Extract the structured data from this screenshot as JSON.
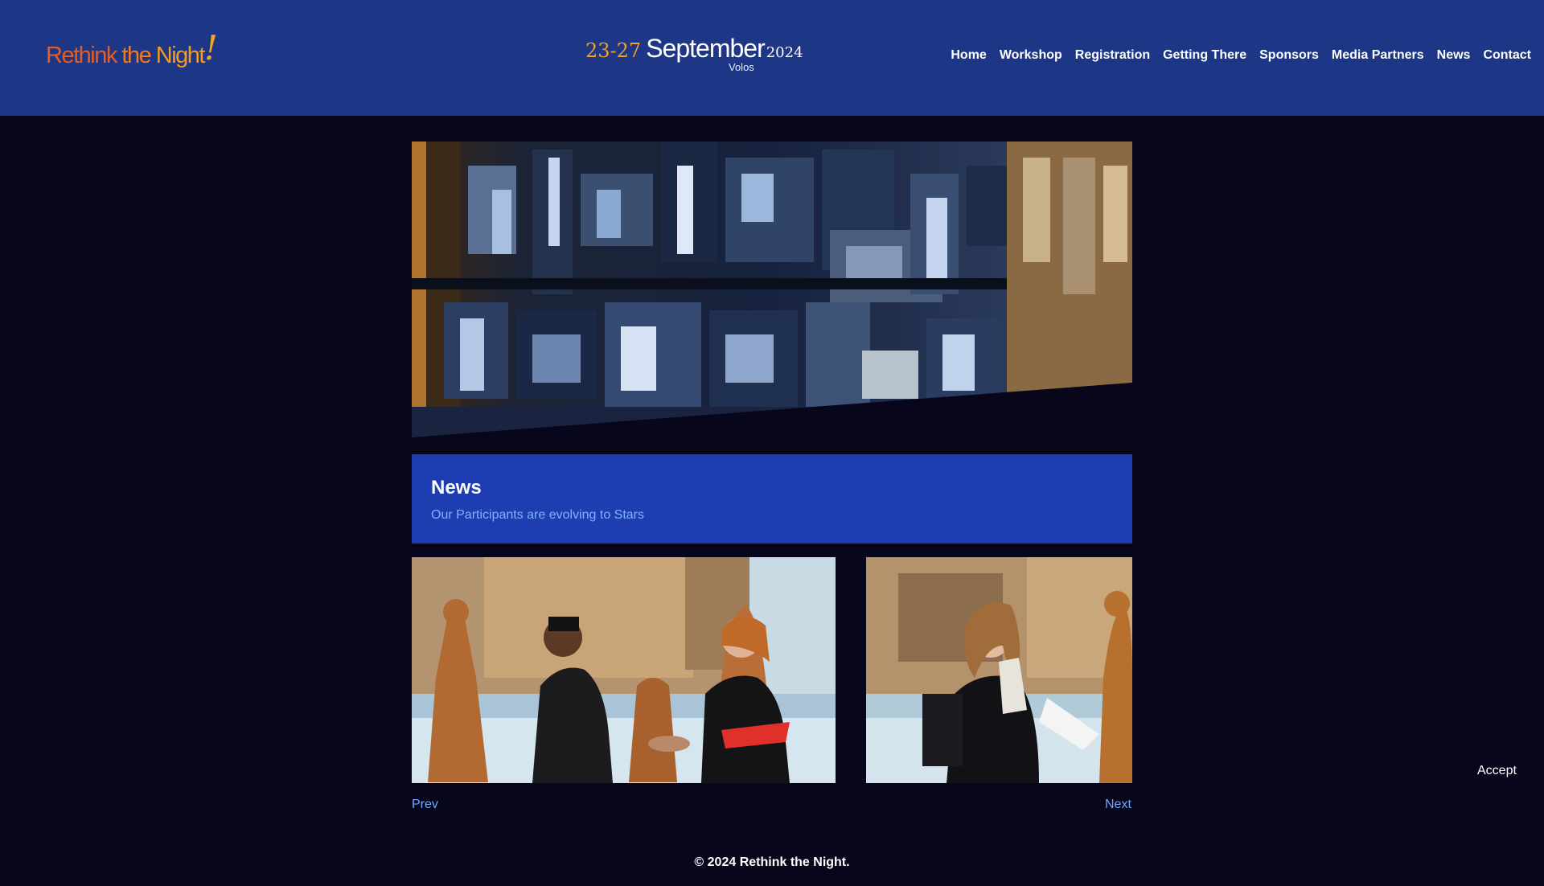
{
  "header": {
    "logo": {
      "part1": "Rethink",
      "part2": " the",
      "part3": " Night",
      "mark": "!"
    },
    "dates": {
      "range": "23-27",
      "month": "September",
      "year": "2024",
      "city": "Volos"
    },
    "nav": [
      "Home",
      "Workshop",
      "Registration",
      "Getting There",
      "Sponsors",
      "Media Partners",
      "News",
      "Contact"
    ]
  },
  "news": {
    "title": "News",
    "subtitle": "Our Participants are evolving to Stars"
  },
  "pager": {
    "prev": "Prev",
    "next": "Next"
  },
  "cookie": {
    "accept": "Accept"
  },
  "footer": {
    "copyright": "© 2024 Rethink the Night."
  },
  "colors": {
    "header_bg": "#1d3686",
    "page_bg": "#07061b",
    "news_bg": "#1e3db0",
    "link": "#6fa8ff",
    "logo_orange": "#e65d24"
  }
}
